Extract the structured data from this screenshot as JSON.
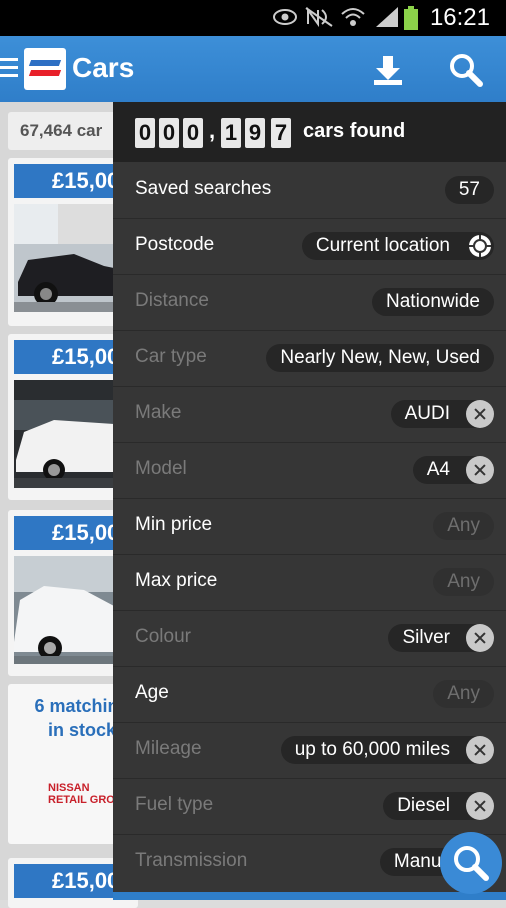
{
  "status_bar": {
    "time": "16:21"
  },
  "app_bar": {
    "title": "Cars"
  },
  "background_list": {
    "result_count": "67,464 car",
    "cards": [
      {
        "price": "£15,00"
      },
      {
        "price": "£15,00"
      },
      {
        "price": "£15,00"
      },
      {
        "price": "£15,00"
      }
    ],
    "promo": {
      "text": "6 matching\nin stock",
      "logo_line1": "NISSAN",
      "logo_line2": "RETAIL GRO"
    }
  },
  "results_panel": {
    "digits": [
      "0",
      "0",
      "0",
      ",",
      "1",
      "9",
      "7"
    ],
    "found_label": "cars found",
    "rows": [
      {
        "label": "Saved searches",
        "value": "57"
      },
      {
        "label": "Postcode",
        "value": "Current location"
      },
      {
        "label": "Distance",
        "value": "Nationwide"
      },
      {
        "label": "Car type",
        "value": "Nearly New, New, Used"
      },
      {
        "label": "Make",
        "value": "AUDI"
      },
      {
        "label": "Model",
        "value": "A4"
      },
      {
        "label": "Min price",
        "value": "Any"
      },
      {
        "label": "Max price",
        "value": "Any"
      },
      {
        "label": "Colour",
        "value": "Silver"
      },
      {
        "label": "Age",
        "value": "Any"
      },
      {
        "label": "Mileage",
        "value": "up to 60,000 miles"
      },
      {
        "label": "Fuel type",
        "value": "Diesel"
      },
      {
        "label": "Transmission",
        "value": "Manua"
      }
    ]
  },
  "colors": {
    "app_bar": "#2f7ec9",
    "panel": "#363636",
    "price_tag": "#2f77c4"
  }
}
